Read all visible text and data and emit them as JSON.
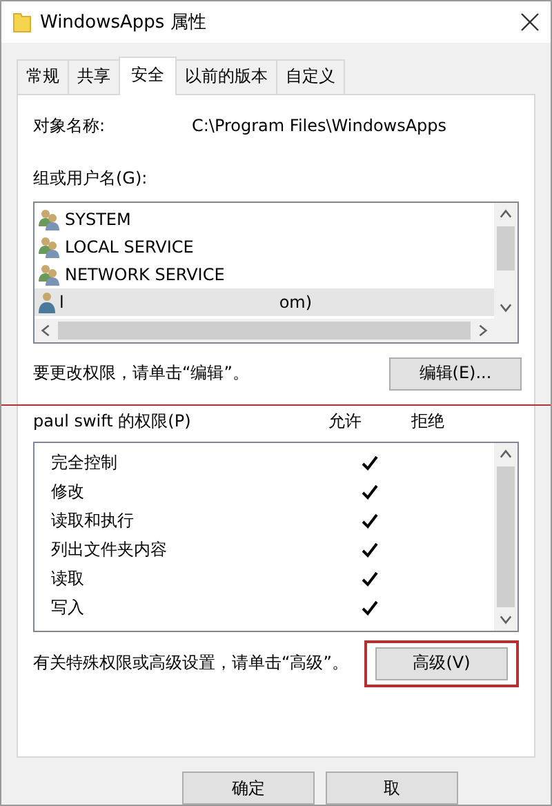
{
  "window": {
    "title": "WindowsApps 属性"
  },
  "tabs": [
    {
      "label": "常规",
      "selected": false
    },
    {
      "label": "共享",
      "selected": false
    },
    {
      "label": "安全",
      "selected": true
    },
    {
      "label": "以前的版本",
      "selected": false
    },
    {
      "label": "自定义",
      "selected": false
    }
  ],
  "object_name": {
    "label": "对象名称:",
    "value": "C:\\Program Files\\WindowsApps"
  },
  "groups": {
    "label": "组或用户名(G):",
    "items": [
      {
        "kind": "group",
        "name": "SYSTEM",
        "selected": false
      },
      {
        "kind": "group",
        "name": "LOCAL SERVICE",
        "selected": false
      },
      {
        "kind": "group",
        "name": "NETWORK SERVICE",
        "selected": false
      },
      {
        "kind": "user",
        "name_start": "l",
        "name_end": "om)",
        "selected": true
      }
    ]
  },
  "edit_hint": "要更改权限，请单击“编辑”。",
  "edit_button": "编辑(E)...",
  "red_rule": true,
  "permissions": {
    "label": "paul swift 的权限(P)",
    "allow_heading": "允许",
    "deny_heading": "拒绝",
    "rows": [
      {
        "name": "完全控制",
        "allow": true
      },
      {
        "name": "修改",
        "allow": true
      },
      {
        "name": "读取和执行",
        "allow": true
      },
      {
        "name": "列出文件夹内容",
        "allow": true
      },
      {
        "name": "读取",
        "allow": true
      },
      {
        "name": "写入",
        "allow": true
      }
    ]
  },
  "advanced_hint": "有关特殊权限或高级设置，请单击“高级”。",
  "advanced_button": {
    "label": "高级(V)",
    "highlighted": true
  },
  "buttons": [
    "确定",
    "取"
  ]
}
